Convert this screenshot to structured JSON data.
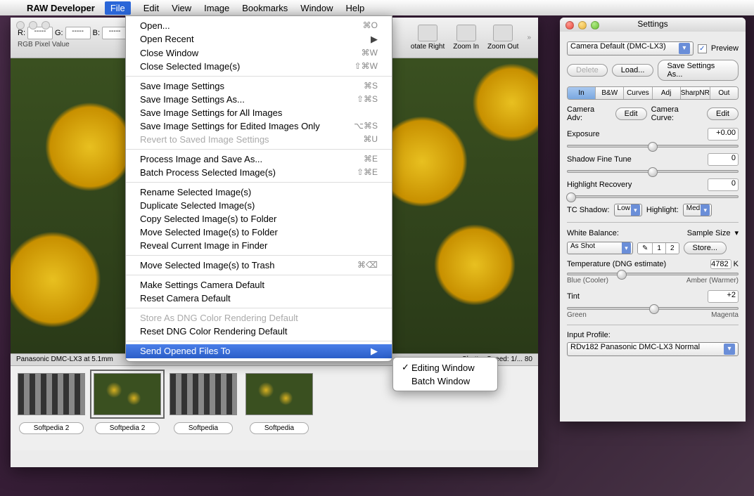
{
  "menubar": {
    "app_name": "RAW Developer",
    "items": [
      "File",
      "Edit",
      "View",
      "Image",
      "Bookmarks",
      "Window",
      "Help"
    ],
    "active_index": 0
  },
  "file_menu": {
    "groups": [
      [
        {
          "label": "Open...",
          "shortcut": "⌘O"
        },
        {
          "label": "Open Recent",
          "submenu": true
        },
        {
          "label": "Close Window",
          "shortcut": "⌘W"
        },
        {
          "label": "Close Selected Image(s)",
          "shortcut": "⇧⌘W"
        }
      ],
      [
        {
          "label": "Save Image Settings",
          "shortcut": "⌘S"
        },
        {
          "label": "Save Image Settings As...",
          "shortcut": "⇧⌘S"
        },
        {
          "label": "Save Image Settings for All Images"
        },
        {
          "label": "Save Image Settings for Edited Images Only",
          "shortcut": "⌥⌘S"
        },
        {
          "label": "Revert to Saved Image Settings",
          "shortcut": "⌘U",
          "disabled": true
        }
      ],
      [
        {
          "label": "Process Image and Save As...",
          "shortcut": "⌘E"
        },
        {
          "label": "Batch Process Selected Image(s)",
          "shortcut": "⇧⌘E"
        }
      ],
      [
        {
          "label": "Rename Selected Image(s)"
        },
        {
          "label": "Duplicate Selected Image(s)"
        },
        {
          "label": "Copy Selected Image(s) to Folder"
        },
        {
          "label": "Move Selected Image(s) to Folder"
        },
        {
          "label": "Reveal Current Image in Finder"
        }
      ],
      [
        {
          "label": "Move Selected Image(s) to Trash",
          "shortcut": "⌘⌫"
        }
      ],
      [
        {
          "label": "Make Settings Camera Default"
        },
        {
          "label": "Reset Camera Default"
        }
      ],
      [
        {
          "label": "Store As DNG Color Rendering Default",
          "disabled": true
        },
        {
          "label": "Reset DNG Color Rendering Default"
        }
      ],
      [
        {
          "label": "Send Opened Files To",
          "submenu": true,
          "highlight": true
        }
      ]
    ],
    "submenu": [
      {
        "label": "Editing Window",
        "checked": true
      },
      {
        "label": "Batch Window"
      }
    ]
  },
  "toolbar": {
    "rgb": {
      "r_label": "R:",
      "g_label": "G:",
      "b_label": "B:",
      "value": "-----",
      "caption": "RGB Pixel Value"
    },
    "buttons": [
      {
        "label": "otate Right"
      },
      {
        "label": "Zoom In"
      },
      {
        "label": "Zoom Out"
      }
    ]
  },
  "status": {
    "left": "Panasonic DMC-LX3 at 5.1mm",
    "right": "Shutter Speed: 1/...                                  80"
  },
  "thumbs": [
    {
      "label": "Softpedia 2",
      "kind": "checker"
    },
    {
      "label": "Softpedia 2",
      "kind": "flower",
      "selected": true
    },
    {
      "label": "Softpedia",
      "kind": "checker"
    },
    {
      "label": "Softpedia",
      "kind": "flower"
    }
  ],
  "settings": {
    "title": "Settings",
    "preset": "Camera Default (DMC-LX3)",
    "preview_label": "Preview",
    "preview_checked": true,
    "buttons": {
      "delete": "Delete",
      "load": "Load...",
      "save_as": "Save Settings As..."
    },
    "tabs": [
      "In",
      "B&W",
      "Curves",
      "Adj",
      "SharpNR",
      "Out"
    ],
    "active_tab": 0,
    "camera_adv_label": "Camera Adv:",
    "edit_btn": "Edit",
    "camera_curve_label": "Camera Curve:",
    "exposure": {
      "label": "Exposure",
      "value": "+0.00",
      "pos": 50
    },
    "shadow_fine": {
      "label": "Shadow Fine Tune",
      "value": "0",
      "pos": 50
    },
    "highlight_recovery": {
      "label": "Highlight Recovery",
      "value": "0",
      "pos": 2
    },
    "tc_shadow_label": "TC Shadow:",
    "tc_shadow_val": "Low",
    "tc_highlight_label": "Highlight:",
    "tc_highlight_val": "Med",
    "wb_label": "White Balance:",
    "sample_size_label": "Sample Size",
    "wb_value": "As Shot",
    "store_btn": "Store...",
    "seg1": "1",
    "seg2": "2",
    "temperature": {
      "label": "Temperature (DNG estimate)",
      "value": "4782",
      "unit": "K",
      "pos": 32,
      "left": "Blue (Cooler)",
      "right": "Amber (Warmer)"
    },
    "tint": {
      "label": "Tint",
      "value": "+2",
      "pos": 51,
      "left": "Green",
      "right": "Magenta"
    },
    "input_profile_label": "Input Profile:",
    "input_profile": "RDv182 Panasonic DMC-LX3 Normal"
  }
}
